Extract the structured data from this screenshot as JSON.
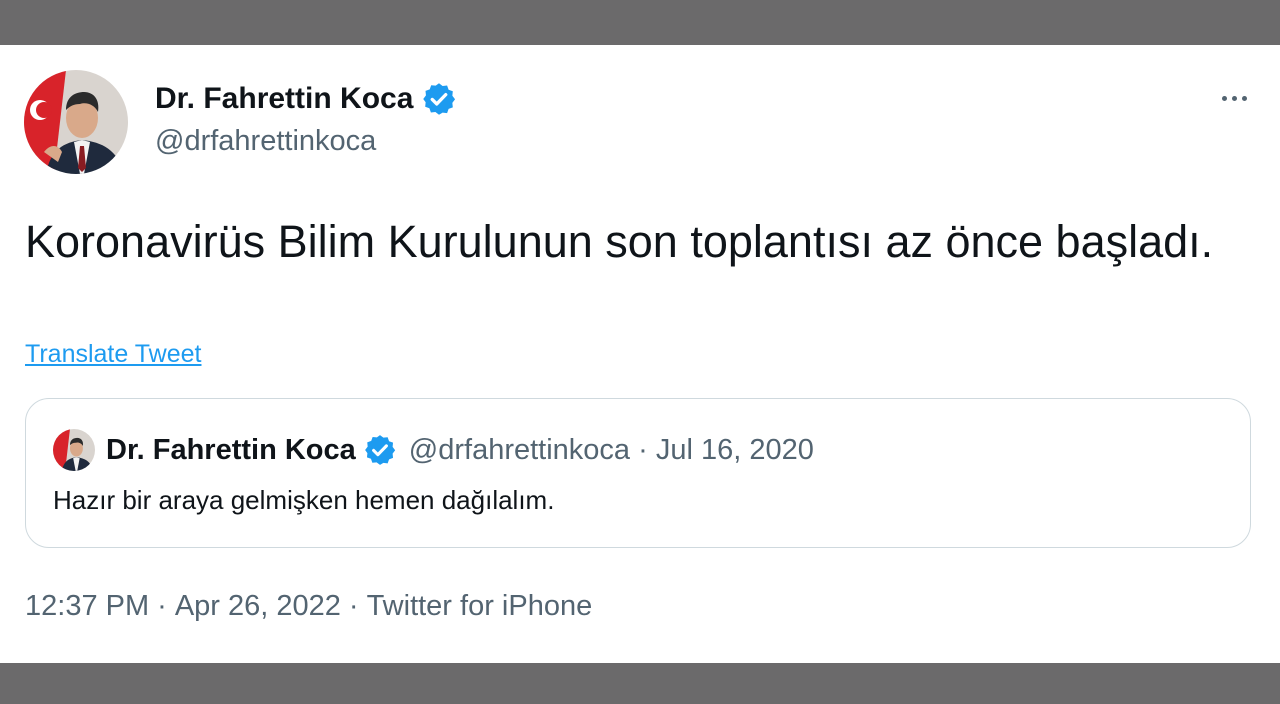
{
  "author": {
    "name": "Dr. Fahrettin Koca",
    "handle": "@drfahrettinkoca",
    "verified_icon": "verified-badge-icon",
    "avatar_icon": "profile-photo"
  },
  "more_icon": "more-options-icon",
  "tweet": {
    "text": "Koronavirüs Bilim Kurulunun son toplantısı az önce başladı.",
    "translate_label": "Translate Tweet"
  },
  "quoted_tweet": {
    "name": "Dr. Fahrettin Koca",
    "meta": "@drfahrettinkoca · Jul 16, 2020",
    "text": "Hazır bir araya gelmişken hemen dağılalım."
  },
  "footer": {
    "time": "12:37 PM",
    "date": "Apr 26, 2022",
    "source": "Twitter for iPhone",
    "separator": "·"
  },
  "colors": {
    "frame": "#6b6a6b",
    "accent": "#1d9bf0",
    "text_primary": "#0f1419",
    "text_secondary": "#536471",
    "border": "#cfd9de"
  }
}
